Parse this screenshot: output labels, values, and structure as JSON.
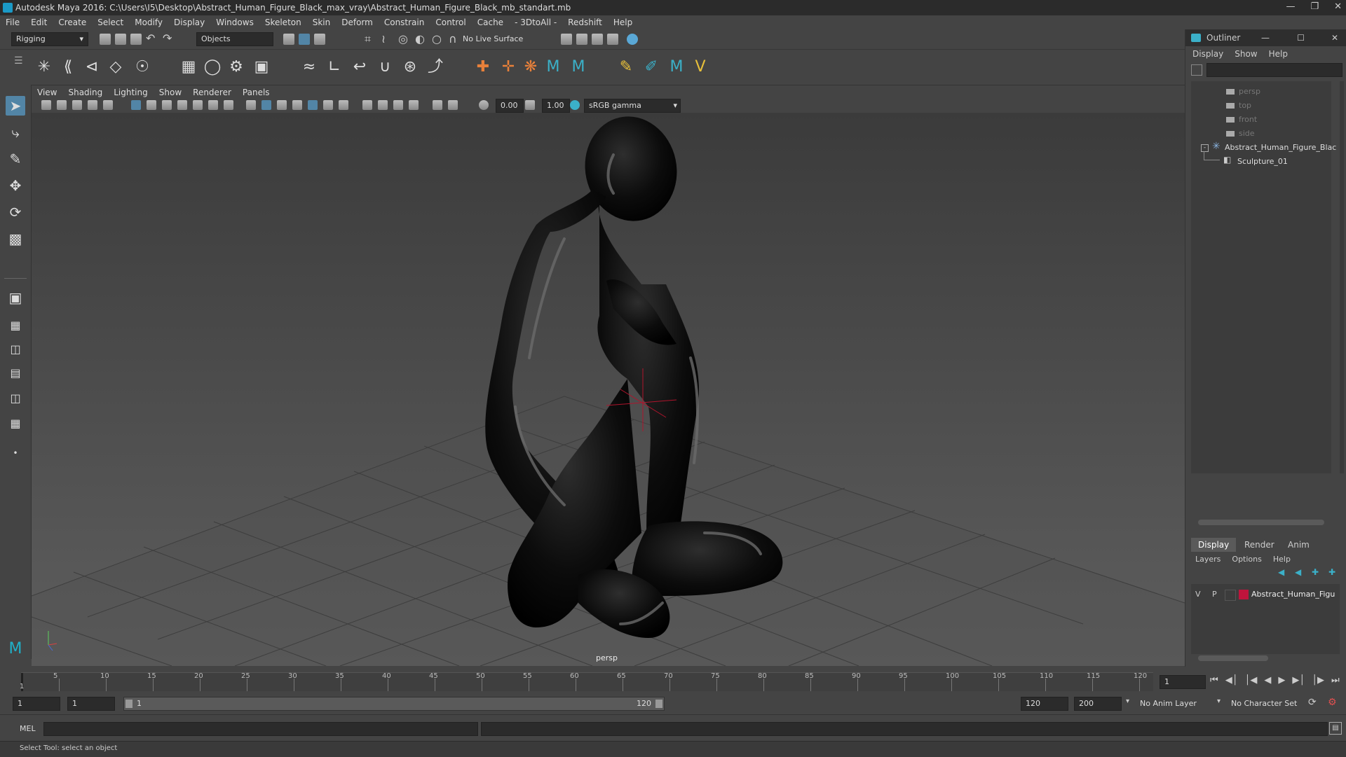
{
  "window": {
    "title": "Autodesk Maya 2016: C:\\Users\\I5\\Desktop\\Abstract_Human_Figure_Black_max_vray\\Abstract_Human_Figure_Black_mb_standart.mb"
  },
  "menu": [
    "File",
    "Edit",
    "Create",
    "Select",
    "Modify",
    "Display",
    "Windows",
    "Skeleton",
    "Skin",
    "Deform",
    "Constrain",
    "Control",
    "Cache",
    "- 3DtoAll -",
    "Redshift",
    "Help"
  ],
  "statusline": {
    "mode": "Rigging",
    "selection_mode": "Objects",
    "live_surface": "No Live Surface"
  },
  "viewport": {
    "menu": [
      "View",
      "Shading",
      "Lighting",
      "Show",
      "Renderer",
      "Panels"
    ],
    "exposure": "0.00",
    "gamma": "1.00",
    "color_space": "sRGB gamma",
    "camera_label": "persp"
  },
  "outliner": {
    "title": "Outliner",
    "menu": [
      "Display",
      "Show",
      "Help"
    ],
    "items": [
      {
        "label": "persp",
        "dim": true
      },
      {
        "label": "top",
        "dim": true
      },
      {
        "label": "front",
        "dim": true
      },
      {
        "label": "side",
        "dim": true
      },
      {
        "label": "Abstract_Human_Figure_Blac",
        "dim": false
      },
      {
        "label": "Sculpture_01",
        "dim": false
      }
    ]
  },
  "layers": {
    "tabs": [
      "Display",
      "Render",
      "Anim"
    ],
    "menu": [
      "Layers",
      "Options",
      "Help"
    ],
    "layer": {
      "v": "V",
      "p": "P",
      "name": "Abstract_Human_Figu",
      "color": "#c0143c"
    }
  },
  "timeline": {
    "ticks": [
      "5",
      "10",
      "15",
      "20",
      "25",
      "30",
      "35",
      "40",
      "45",
      "50",
      "55",
      "60",
      "65",
      "70",
      "75",
      "80",
      "85",
      "90",
      "95",
      "100",
      "105",
      "110",
      "115",
      "120"
    ],
    "start_tick": "1",
    "current_frame": "1"
  },
  "range": {
    "start": "1",
    "playback_start": "1",
    "slider_start": "1",
    "slider_end": "120",
    "playback_end": "120",
    "end": "200",
    "anim_layer": "No Anim Layer",
    "character_set": "No Character Set"
  },
  "command": {
    "label": "MEL"
  },
  "help": {
    "text": "Select Tool: select an object"
  },
  "colors": {
    "accent": "#5285a6",
    "layer": "#c0143c"
  }
}
